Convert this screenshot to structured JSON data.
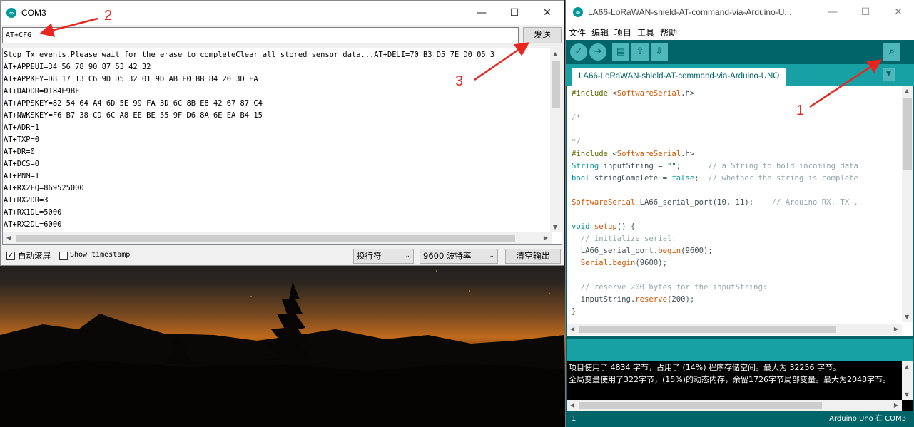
{
  "serial_monitor": {
    "title": "COM3",
    "command_value": "AT+CFG",
    "send_label": "发送",
    "output_lines": [
      "Stop Tx events,Please wait for the erase to completeClear all stored sensor data...AT+DEUI=70 B3 D5 7E D0 05 3",
      "AT+APPEUI=34 56 78 90 87 53 42 32",
      "AT+APPKEY=D8 17 13 C6 9D D5 32 01 9D AB F0 BB 84 20 3D EA",
      "AT+DADDR=0184E9BF",
      "AT+APPSKEY=82 54 64 A4 6D 5E 99 FA 3D 6C 8B E8 42 67 87 C4",
      "AT+NWKSKEY=F6 B7 38 CD 6C A8 EE BE 55 9F D6 8A 6E EA B4 15",
      "AT+ADR=1",
      "AT+TXP=0",
      "AT+DR=0",
      "AT+DCS=0",
      "AT+PNM=1",
      "AT+RX2FQ=869525000",
      "AT+RX2DR=3",
      "AT+RX1DL=5000",
      "AT+RX2DL=6000"
    ],
    "autoscroll_label": "自动滚屏",
    "autoscroll_checked": true,
    "timestamp_label": "Show timestamp",
    "timestamp_checked": false,
    "line_ending": "换行符",
    "baud": "9600 波特率",
    "clear_label": "清空输出"
  },
  "ide": {
    "title": "LA66-LoRaWAN-shield-AT-command-via-Arduino-U...",
    "menu": [
      "文件",
      "编辑",
      "项目",
      "工具",
      "帮助"
    ],
    "tab_label": "LA66-LoRaWAN-shield-AT-command-via-Arduino-UNO",
    "console_lines": [
      "项目使用了 4834 字节，占用了 (14%) 程序存储空间。最大为 32256 字节。",
      "全局变量使用了322字节，(15%)的动态内存，余留1726字节局部变量。最大为2048字节。"
    ],
    "line_number": "1",
    "board_status": "Arduino Uno 在 COM3"
  },
  "annotations": [
    "1",
    "2",
    "3"
  ],
  "icons": {
    "verify": "checkmark-icon",
    "upload": "arrow-right-icon",
    "new": "new-file-icon",
    "open": "arrow-up-icon",
    "save": "arrow-down-icon",
    "serial_monitor": "magnifier-icon"
  },
  "colors": {
    "arduino_teal": "#006468",
    "arduino_tab": "#17a1a5",
    "annotation_red": "#e8261f"
  }
}
